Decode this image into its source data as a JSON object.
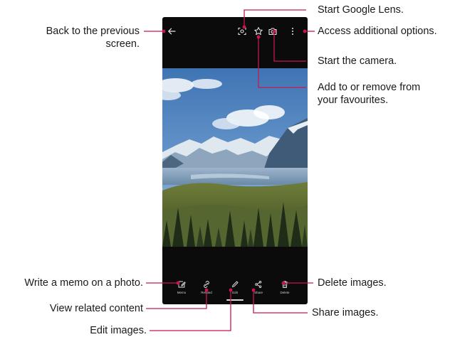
{
  "phone": {
    "bottom_bar": {
      "memo_label": "Memo",
      "related_label": "Related",
      "edit_label": "Edit",
      "share_label": "Share",
      "delete_label": "Delete"
    }
  },
  "callouts": {
    "start_google_lens": "Start Google Lens.",
    "access_options": "Access additional options.",
    "start_camera": "Start the camera.",
    "favourites_line1": "Add to or remove from",
    "favourites_line2": "your favourites.",
    "back_line1": "Back to the previous",
    "back_line2": "screen.",
    "write_memo": "Write a memo on a photo.",
    "view_related": "View related content",
    "edit_images": "Edit images.",
    "delete_images": "Delete images.",
    "share_images": "Share images."
  },
  "colors": {
    "accent": "#c8174e",
    "screen_bg": "#0b0b0b",
    "icon": "#e8e8e8"
  }
}
